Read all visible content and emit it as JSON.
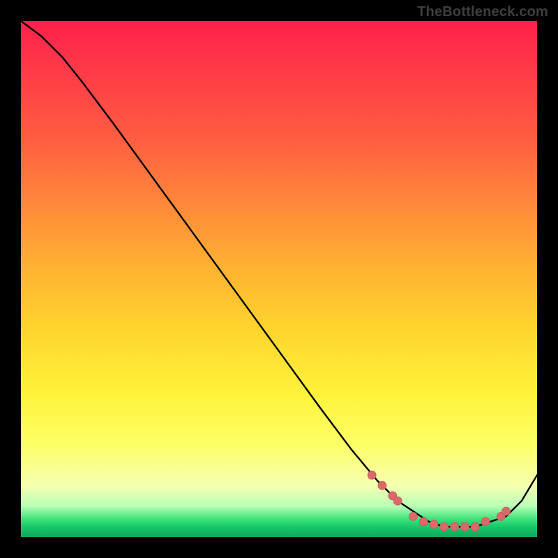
{
  "watermark": "TheBottleneck.com",
  "colors": {
    "background": "#000000",
    "curve": "#000000",
    "marker": "#d96a6a",
    "gradient_top": "#ff1f4b",
    "gradient_mid": "#ffd52e",
    "gradient_bottom": "#0fa85b"
  },
  "chart_data": {
    "type": "line",
    "title": "",
    "xlabel": "",
    "ylabel": "",
    "xlim": [
      0,
      100
    ],
    "ylim": [
      0,
      100
    ],
    "grid": false,
    "legend": false,
    "series": [
      {
        "name": "curve",
        "x": [
          0,
          4,
          8,
          12,
          18,
          26,
          34,
          42,
          50,
          58,
          64,
          69,
          73,
          76,
          79,
          82,
          85,
          88,
          91,
          94,
          97,
          100
        ],
        "y": [
          100,
          97,
          93,
          88,
          80,
          69,
          58,
          47,
          36,
          25,
          17,
          11,
          7,
          5,
          3,
          2,
          2,
          2,
          3,
          4,
          7,
          12
        ]
      }
    ],
    "markers": {
      "name": "highlighted-points",
      "x": [
        68,
        70,
        72,
        73,
        76,
        78,
        80,
        82,
        84,
        86,
        88,
        90,
        93,
        94
      ],
      "y": [
        12,
        10,
        8,
        7,
        4,
        3,
        2.5,
        2,
        2,
        2,
        2,
        3,
        4,
        5
      ]
    }
  }
}
